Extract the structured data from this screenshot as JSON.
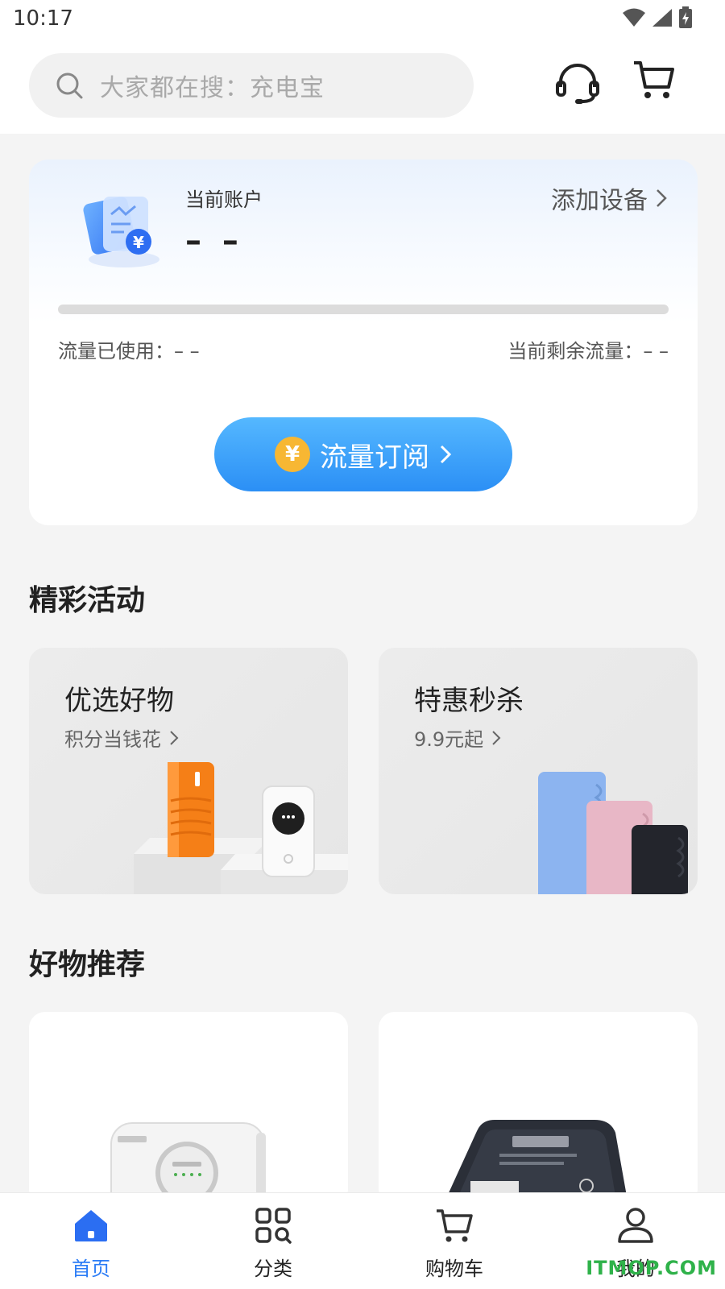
{
  "status_bar": {
    "time": "10:17"
  },
  "header": {
    "search_placeholder": "大家都在搜：充电宝",
    "service_icon": "headset-icon",
    "cart_icon": "cart-icon"
  },
  "account": {
    "label": "当前账户",
    "value": "– –",
    "add_device_label": "添加设备",
    "usage_fraction": 0,
    "used_text": "流量已使用：– –",
    "remain_text": "当前剩余流量：– –",
    "subscribe_label": "流量订阅",
    "subscribe_coin": "¥"
  },
  "activities": {
    "title": "精彩活动",
    "cards": [
      {
        "title": "优选好物",
        "subtitle": "积分当钱花"
      },
      {
        "title": "特惠秒杀",
        "subtitle": "9.9元起"
      }
    ]
  },
  "recommend": {
    "title": "好物推荐"
  },
  "bottom_nav": {
    "items": [
      {
        "label": "首页",
        "icon": "home-icon",
        "active": true
      },
      {
        "label": "分类",
        "icon": "category-icon",
        "active": false
      },
      {
        "label": "购物车",
        "icon": "cart-icon",
        "active": false
      },
      {
        "label": "我的",
        "icon": "user-icon",
        "active": false
      }
    ]
  },
  "colors": {
    "accent": "#2b7cf6",
    "button_gradient_top": "#55b8ff",
    "button_gradient_bottom": "#2b8ff5",
    "coin": "#f7b733"
  },
  "watermark": "ITMOP.COM"
}
